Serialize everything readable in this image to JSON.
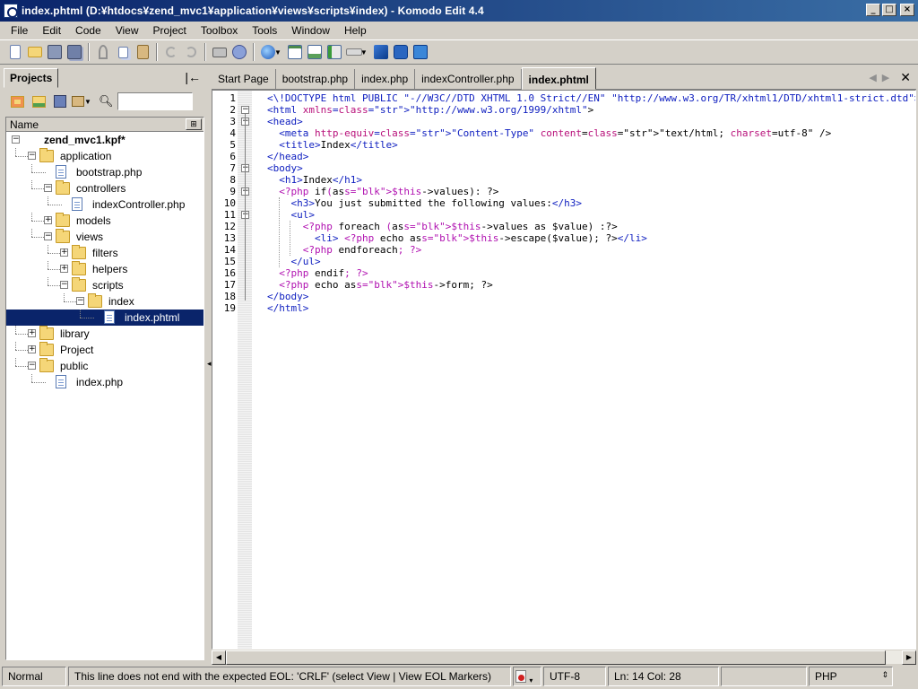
{
  "window": {
    "title": "index.phtml (D:¥htdocs¥zend_mvc1¥application¥views¥scripts¥index) - Komodo Edit 4.4",
    "btn_min": "_",
    "btn_max": "□",
    "btn_close": "×"
  },
  "menu": {
    "items": [
      "File",
      "Edit",
      "Code",
      "View",
      "Project",
      "Toolbox",
      "Tools",
      "Window",
      "Help"
    ]
  },
  "toolbar": {
    "icons": [
      "new-file-icon",
      "open-folder-icon",
      "save-icon",
      "save-all-icon",
      "cut-icon",
      "copy-icon",
      "paste-icon",
      "undo-icon",
      "redo-icon",
      "print-icon",
      "help-icon",
      "browser-preview-icon",
      "view-source-icon",
      "view-image-icon",
      "view-back-icon",
      "view-toggle-icon",
      "toolbox-icon",
      "refresh-icon",
      "debug-icon"
    ]
  },
  "projects_pane": {
    "tab_label": "Projects",
    "collapse_glyph": "|←",
    "search_placeholder": "",
    "column_header": "Name",
    "tree": [
      {
        "label": "zend_mvc1.kpf*",
        "depth": 0,
        "type": "project",
        "expander": "−",
        "bold": true
      },
      {
        "label": "application",
        "depth": 1,
        "type": "folder",
        "expander": "−"
      },
      {
        "label": "bootstrap.php",
        "depth": 2,
        "type": "file",
        "expander": ""
      },
      {
        "label": "controllers",
        "depth": 2,
        "type": "folder",
        "expander": "−"
      },
      {
        "label": "indexController.php",
        "depth": 3,
        "type": "file",
        "expander": ""
      },
      {
        "label": "models",
        "depth": 2,
        "type": "folder",
        "expander": "+"
      },
      {
        "label": "views",
        "depth": 2,
        "type": "folder",
        "expander": "−"
      },
      {
        "label": "filters",
        "depth": 3,
        "type": "folder",
        "expander": "+"
      },
      {
        "label": "helpers",
        "depth": 3,
        "type": "folder",
        "expander": "+"
      },
      {
        "label": "scripts",
        "depth": 3,
        "type": "folder",
        "expander": "−"
      },
      {
        "label": "index",
        "depth": 4,
        "type": "folder",
        "expander": "−"
      },
      {
        "label": "index.phtml",
        "depth": 5,
        "type": "file",
        "expander": "",
        "selected": true
      },
      {
        "label": "library",
        "depth": 1,
        "type": "folder",
        "expander": "+"
      },
      {
        "label": "Project",
        "depth": 1,
        "type": "folder",
        "expander": "+"
      },
      {
        "label": "public",
        "depth": 1,
        "type": "folder",
        "expander": "−"
      },
      {
        "label": "index.php",
        "depth": 2,
        "type": "file",
        "expander": ""
      }
    ]
  },
  "editor": {
    "tabs": [
      "Start Page",
      "bootstrap.php",
      "index.php",
      "indexController.php",
      "index.phtml"
    ],
    "active_tab": "index.phtml",
    "lines": [
      {
        "n": "1",
        "fold": "",
        "text": "<\\!DOCTYPE html PUBLIC \"-//W3C//DTD XHTML 1.0 Strict//EN\" \"http://www.w3.org/TR/xhtml1/DTD/xhtml1-strict.dtd\">"
      },
      {
        "n": "2",
        "fold": "−",
        "text": "<html xmlns=\"http://www.w3.org/1999/xhtml\">"
      },
      {
        "n": "3",
        "fold": "−",
        "text": "<head>"
      },
      {
        "n": "4",
        "fold": "",
        "text": "  <meta http-equiv=\"Content-Type\" content=\"text/html; charset=utf-8\" />"
      },
      {
        "n": "5",
        "fold": "",
        "text": "  <title>Index</title>"
      },
      {
        "n": "6",
        "fold": "",
        "text": "</head>"
      },
      {
        "n": "7",
        "fold": "−",
        "text": "<body>"
      },
      {
        "n": "8",
        "fold": "",
        "text": "  <h1>Index</h1>"
      },
      {
        "n": "9",
        "fold": "−",
        "text": "  <?php if($this->values): ?>"
      },
      {
        "n": "10",
        "fold": "",
        "text": "    <h3>You just submitted the following values:</h3>"
      },
      {
        "n": "11",
        "fold": "−",
        "text": "    <ul>"
      },
      {
        "n": "12",
        "fold": "",
        "text": "      <?php foreach ($this->values as $value) :?>"
      },
      {
        "n": "13",
        "fold": "",
        "text": "        <li> <?php echo $this->escape($value); ?></li>"
      },
      {
        "n": "14",
        "fold": "",
        "text": "      <?php endforeach; ?>"
      },
      {
        "n": "15",
        "fold": "",
        "text": "    </ul>"
      },
      {
        "n": "16",
        "fold": "",
        "text": "  <?php endif; ?>"
      },
      {
        "n": "17",
        "fold": "",
        "text": "  <?php echo $this->form; ?>"
      },
      {
        "n": "18",
        "fold": "",
        "text": "</body>"
      },
      {
        "n": "19",
        "fold": "",
        "text": "</html>"
      }
    ]
  },
  "statusbar": {
    "mode": "Normal",
    "message": "This line does not end with the expected EOL: 'CRLF' (select View | View EOL Markers)",
    "encoding": "UTF-8",
    "position": "Ln: 14 Col: 28",
    "language": "PHP"
  }
}
